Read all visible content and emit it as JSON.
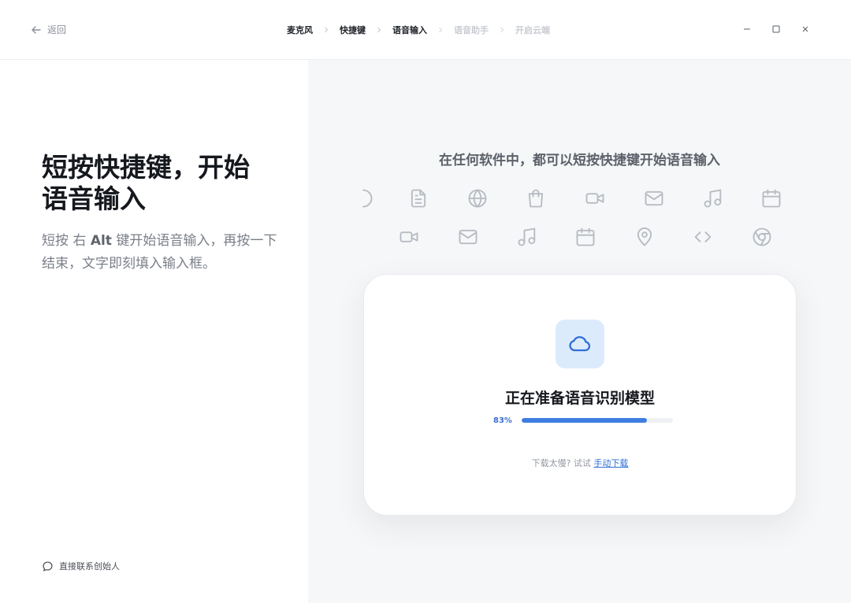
{
  "topbar": {
    "back_label": "返回",
    "steps": [
      {
        "label": "麦克风",
        "state": "done"
      },
      {
        "label": "快捷键",
        "state": "done"
      },
      {
        "label": "语音输入",
        "state": "current"
      },
      {
        "label": "语音助手",
        "state": "upcoming"
      },
      {
        "label": "开启云端",
        "state": "upcoming"
      }
    ],
    "window_controls": [
      "minimize-icon",
      "maximize-icon",
      "close-icon"
    ]
  },
  "left": {
    "heading_line1": "短按快捷键，开始",
    "heading_line2": "语音输入",
    "desc_pre": "短按 右 ",
    "desc_key": "Alt",
    "desc_post": " 键开始语音输入，再按一下结束，文字即刻填入输入框。",
    "contact_label": "直接联系创始人"
  },
  "right": {
    "title": "在任何软件中，都可以短按快捷键开始语音输入",
    "icon_row_1": [
      "partial-circle-icon",
      "document-icon",
      "globe-icon",
      "shopping-bag-icon",
      "video-icon",
      "mail-icon",
      "music-icon",
      "calendar-icon"
    ],
    "icon_row_2": [
      "video-icon",
      "mail-icon",
      "music-icon",
      "calendar-icon",
      "location-pin-icon",
      "code-icon",
      "chrome-icon"
    ]
  },
  "card": {
    "icon": "cloud-icon",
    "title": "正在准备语音识别模型",
    "progress_label": "83%",
    "progress_value": 0.83,
    "hint_prefix": "下载太慢? 试试 ",
    "hint_link": "手动下载"
  },
  "colors": {
    "accent": "#3f7ee0",
    "icon_tile_bg": "#dcebfc",
    "panel_bg": "#f6f7f8",
    "icon_stroke": "#b7bbc2"
  }
}
